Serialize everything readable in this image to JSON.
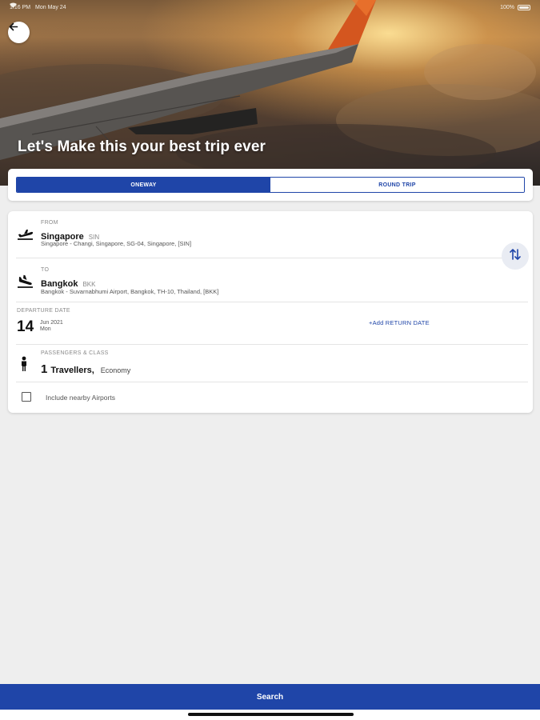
{
  "status_bar": {
    "time": "1:16 PM",
    "date": "Mon May 24",
    "battery": "100%"
  },
  "hero": {
    "title": "Let's Make this your best trip ever"
  },
  "trip_type": {
    "oneway_label": "ONEWAY",
    "roundtrip_label": "ROUND TRIP",
    "selected": "ONEWAY"
  },
  "from": {
    "label": "FROM",
    "city": "Singapore",
    "code": "SIN",
    "airport": "Singapore - Changi, Singapore, SG-04, Singapore, [SIN]"
  },
  "to": {
    "label": "TO",
    "city": "Bangkok",
    "code": "BKK",
    "airport": "Bangkok - Suvarnabhumi Airport, Bangkok, TH-10, Thailand, [BKK]"
  },
  "departure": {
    "label": "DEPARTURE DATE",
    "day": "14",
    "month_year": "Jun 2021",
    "weekday": "Mon",
    "add_return_label": "+Add RETURN DATE"
  },
  "passengers": {
    "label": "PASSENGERS & CLASS",
    "count": "1",
    "travellers_label": "Travellers,",
    "class": "Economy"
  },
  "nearby": {
    "label": "Include nearby Airports",
    "checked": false
  },
  "search_label": "Search",
  "colors": {
    "primary": "#1f45a8",
    "background": "#eeeeee",
    "card": "#ffffff"
  }
}
